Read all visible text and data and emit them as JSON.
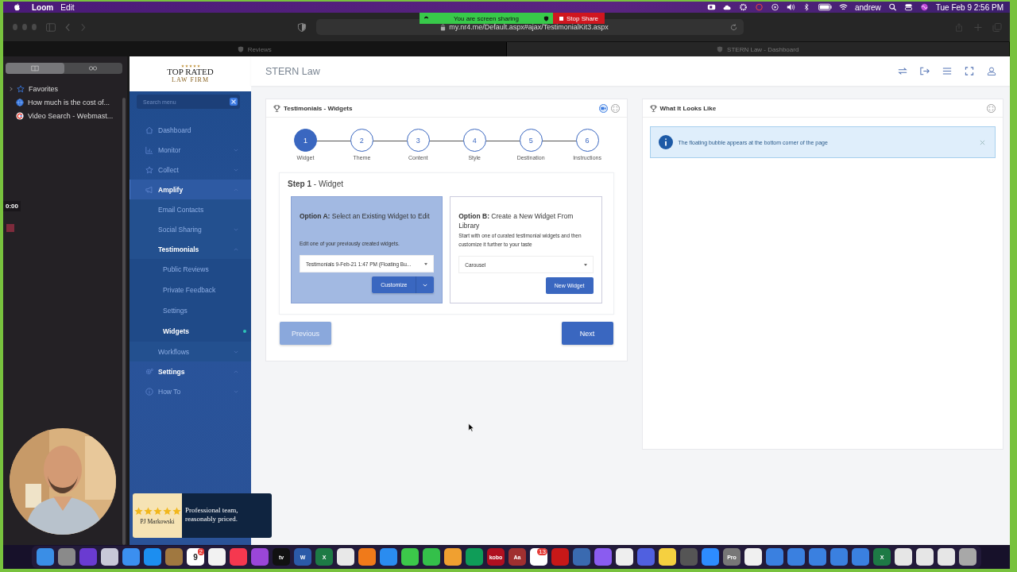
{
  "menubar": {
    "app": "Loom",
    "menus": [
      "Edit"
    ],
    "user": "andrew",
    "clock": "Tue Feb 9  2:56 PM"
  },
  "share_banner": {
    "status": "You are screen sharing",
    "stop": "Stop Share"
  },
  "browser": {
    "url": "my.nr4.me/Default.aspx#ajax/TestimonialKit3.aspx",
    "tabs": [
      {
        "title": "Reviews",
        "selected": false
      },
      {
        "title": "STERN Law - Dashboard",
        "selected": true
      }
    ]
  },
  "browser_sidebar": {
    "modes": [
      {
        "kind": "bookmarks",
        "selected": true
      },
      {
        "kind": "reading-list",
        "selected": false
      }
    ],
    "favorites": {
      "label": "Favorites",
      "expanded": false
    },
    "bookmarks": [
      {
        "title": "How much is the cost of...",
        "kind": "globe"
      },
      {
        "title": "Video Search - Webmast...",
        "kind": "google"
      }
    ]
  },
  "recorder": {
    "timer": "0:00"
  },
  "app": {
    "logo": {
      "stars": 5,
      "name": "TOP RATED",
      "subtitle": "LAW FIRM"
    },
    "search_placeholder": "Search menu",
    "title": "STERN Law",
    "nav": [
      {
        "label": "Dashboard",
        "kind": "home",
        "selected": false
      },
      {
        "label": "Monitor",
        "kind": "chart",
        "selected": false,
        "expanded": false
      },
      {
        "label": "Collect",
        "kind": "star",
        "selected": false,
        "expanded": false
      },
      {
        "label": "Amplify",
        "kind": "megaphone",
        "selected": false,
        "expanded": true,
        "children": [
          {
            "label": "Email Contacts",
            "selected": false
          },
          {
            "label": "Social Sharing",
            "selected": false,
            "expanded": false
          },
          {
            "label": "Testimonials",
            "selected": false,
            "expanded": true,
            "children": [
              {
                "label": "Public Reviews",
                "selected": false
              },
              {
                "label": "Private Feedback",
                "selected": false
              },
              {
                "label": "Settings",
                "selected": false
              },
              {
                "label": "Widgets",
                "selected": true
              }
            ]
          },
          {
            "label": "Workflows",
            "selected": false,
            "expanded": false
          }
        ]
      },
      {
        "label": "Settings",
        "kind": "gear",
        "selected": false,
        "expanded": true
      },
      {
        "label": "How To",
        "kind": "info",
        "selected": false,
        "expanded": false
      }
    ]
  },
  "wizard": {
    "title": "Testimonials - Widgets",
    "steps": [
      {
        "number": "1",
        "label": "Widget",
        "selected": true
      },
      {
        "number": "2",
        "label": "Theme",
        "selected": false
      },
      {
        "number": "3",
        "label": "Content",
        "selected": false
      },
      {
        "number": "4",
        "label": "Style",
        "selected": false
      },
      {
        "number": "5",
        "label": "Destination",
        "selected": false
      },
      {
        "number": "6",
        "label": "Instructions",
        "selected": false
      }
    ],
    "step_title": "**Step 1** - Widget",
    "options": [
      {
        "title": "**Option A:** Select an Existing Widget to Edit",
        "description": "Edit one of your previously created widgets.",
        "select": "Testimonials 9-Feb-21 1:47 PM (Floating Bu...",
        "button": "Customize",
        "kind": "split",
        "selected": true
      },
      {
        "title": "**Option B:** Create a New Widget From Library",
        "description": "Start with one of curated testimonial widgets and then customize it further to your taste",
        "select": "Carousel",
        "button": "New Widget",
        "kind": "plain",
        "selected": false
      }
    ],
    "previous": {
      "label": "Previous",
      "disabled": true
    },
    "next": {
      "label": "Next",
      "disabled": false
    }
  },
  "preview": {
    "title": "What It Looks Like",
    "notice": "The floating bubble appears at the bottom corner of the page"
  },
  "review_bubble": {
    "stars": 5,
    "author": "PJ Markowski",
    "text": "Professional team, reasonably priced."
  },
  "dock": [
    {
      "color": "#3a8ee6"
    },
    {
      "color": "#8a8a8a"
    },
    {
      "color": "#6a3bd1"
    },
    {
      "color": "#c8c8d8"
    },
    {
      "color": "#3b8ff0"
    },
    {
      "color": "#1c8ef0"
    },
    {
      "color": "#a07840"
    },
    {
      "color": "#ffffff",
      "glyph": "9",
      "badge": "2"
    },
    {
      "color": "#f2f2f2"
    },
    {
      "color": "#f5384f"
    },
    {
      "color": "#9a46d8"
    },
    {
      "color": "#111111",
      "glyph": "tv"
    },
    {
      "color": "#2b5aa8",
      "glyph": "W"
    },
    {
      "color": "#1d7a45",
      "glyph": "X"
    },
    {
      "color": "#e8e8e8"
    },
    {
      "color": "#f07a1a"
    },
    {
      "color": "#2a8cf0"
    },
    {
      "color": "#3cc84a"
    },
    {
      "color": "#34c04a"
    },
    {
      "color": "#f0a030"
    },
    {
      "color": "#0f9d58"
    },
    {
      "color": "#b01020",
      "glyph": "kobo"
    },
    {
      "color": "#a03030",
      "glyph": "Aa"
    },
    {
      "color": "#ffffff",
      "badge": "13"
    },
    {
      "color": "#c81818"
    },
    {
      "color": "#3a6ab0"
    },
    {
      "color": "#8a5cf0"
    },
    {
      "color": "#eeeeee"
    },
    {
      "color": "#5060e0"
    },
    {
      "color": "#f5d040"
    },
    {
      "color": "#555555"
    },
    {
      "color": "#2d8cff"
    },
    {
      "color": "#777777",
      "glyph": "Pro"
    },
    {
      "color": "#f0f0f0"
    },
    {
      "color": "#3a80e0"
    },
    {
      "color": "#3a80e0"
    },
    {
      "color": "#3a80e0"
    },
    {
      "color": "#3a80e0"
    },
    {
      "color": "#3a80e0"
    },
    {
      "color": "#1d7a45",
      "glyph": "X"
    },
    {
      "color": "#e6e6e6"
    },
    {
      "color": "#e6e6e6"
    },
    {
      "color": "#e6e6e6"
    },
    {
      "color": "#a8a8a8"
    }
  ]
}
